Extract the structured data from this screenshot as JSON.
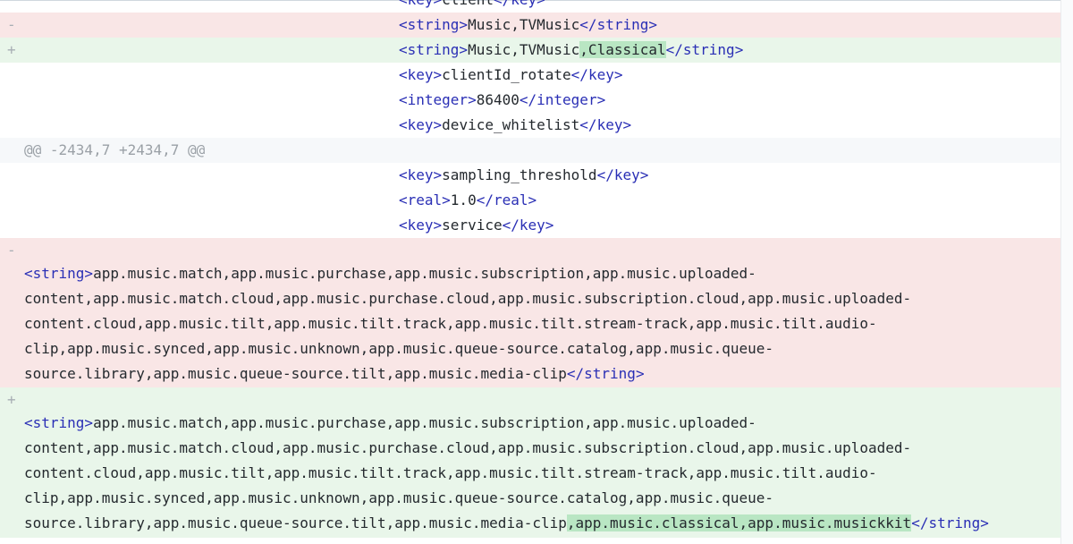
{
  "diff": {
    "rows": [
      {
        "kind": "ctx",
        "parts": [
          {
            "t": "tag",
            "v": "<key>"
          },
          {
            "t": "txt",
            "v": "client"
          },
          {
            "t": "tag",
            "v": "</key>"
          }
        ]
      },
      {
        "kind": "del",
        "marker": "-",
        "parts": [
          {
            "t": "tag",
            "v": "<string>"
          },
          {
            "t": "txt",
            "v": "Music,TVMusic"
          },
          {
            "t": "tag",
            "v": "</string>"
          }
        ]
      },
      {
        "kind": "add",
        "marker": "+",
        "parts": [
          {
            "t": "tag",
            "v": "<string>"
          },
          {
            "t": "txt",
            "v": "Music,TVMusic"
          },
          {
            "t": "hl",
            "v": ",Classical"
          },
          {
            "t": "tag",
            "v": "</string>"
          }
        ]
      },
      {
        "kind": "ctx",
        "parts": [
          {
            "t": "tag",
            "v": "<key>"
          },
          {
            "t": "txt",
            "v": "clientId_rotate"
          },
          {
            "t": "tag",
            "v": "</key>"
          }
        ]
      },
      {
        "kind": "ctx",
        "parts": [
          {
            "t": "tag",
            "v": "<integer>"
          },
          {
            "t": "txt",
            "v": "86400"
          },
          {
            "t": "tag",
            "v": "</integer>"
          }
        ]
      },
      {
        "kind": "ctx",
        "parts": [
          {
            "t": "tag",
            "v": "<key>"
          },
          {
            "t": "txt",
            "v": "device_whitelist"
          },
          {
            "t": "tag",
            "v": "</key>"
          }
        ]
      },
      {
        "kind": "hunk",
        "text": "@@ -2434,7 +2434,7 @@"
      },
      {
        "kind": "ctx",
        "parts": [
          {
            "t": "tag",
            "v": "<key>"
          },
          {
            "t": "txt",
            "v": "sampling_threshold"
          },
          {
            "t": "tag",
            "v": "</key>"
          }
        ]
      },
      {
        "kind": "ctx",
        "parts": [
          {
            "t": "tag",
            "v": "<real>"
          },
          {
            "t": "txt",
            "v": "1.0"
          },
          {
            "t": "tag",
            "v": "</real>"
          }
        ]
      },
      {
        "kind": "ctx",
        "parts": [
          {
            "t": "tag",
            "v": "<key>"
          },
          {
            "t": "txt",
            "v": "service"
          },
          {
            "t": "tag",
            "v": "</key>"
          }
        ]
      }
    ],
    "blocks": [
      {
        "kind": "del",
        "marker": "-",
        "lines": [
          [
            {
              "t": "tag",
              "v": "<string>"
            },
            {
              "t": "txt",
              "v": "app.music.match,app.music.purchase,app.music.subscription,app.music.uploaded-"
            }
          ],
          [
            {
              "t": "txt",
              "v": "content,app.music.match.cloud,app.music.purchase.cloud,app.music.subscription.cloud,app.music.uploaded-"
            }
          ],
          [
            {
              "t": "txt",
              "v": "content.cloud,app.music.tilt,app.music.tilt.track,app.music.tilt.stream-track,app.music.tilt.audio-"
            }
          ],
          [
            {
              "t": "txt",
              "v": "clip,app.music.synced,app.music.unknown,app.music.queue-source.catalog,app.music.queue-"
            }
          ],
          [
            {
              "t": "txt",
              "v": "source.library,app.music.queue-source.tilt,app.music.media-clip"
            },
            {
              "t": "tag",
              "v": "</string>"
            }
          ]
        ]
      },
      {
        "kind": "add",
        "marker": "+",
        "lines": [
          [
            {
              "t": "tag",
              "v": "<string>"
            },
            {
              "t": "txt",
              "v": "app.music.match,app.music.purchase,app.music.subscription,app.music.uploaded-"
            }
          ],
          [
            {
              "t": "txt",
              "v": "content,app.music.match.cloud,app.music.purchase.cloud,app.music.subscription.cloud,app.music.uploaded-"
            }
          ],
          [
            {
              "t": "txt",
              "v": "content.cloud,app.music.tilt,app.music.tilt.track,app.music.tilt.stream-track,app.music.tilt.audio-"
            }
          ],
          [
            {
              "t": "txt",
              "v": "clip,app.music.synced,app.music.unknown,app.music.queue-source.catalog,app.music.queue-"
            }
          ],
          [
            {
              "t": "txt",
              "v": "source.library,app.music.queue-source.tilt,app.music.media-clip"
            },
            {
              "t": "hl",
              "v": ",app.music.classical,app.music.musickkit"
            },
            {
              "t": "tag",
              "v": "</string>"
            }
          ]
        ]
      }
    ]
  },
  "colors": {
    "deletion_bg": "#f9e6e6",
    "addition_bg": "#e9f6ea",
    "addition_highlight": "#b9e6c3",
    "hunk_bg": "#f6f8fa",
    "tag": "#2a2fb5"
  }
}
